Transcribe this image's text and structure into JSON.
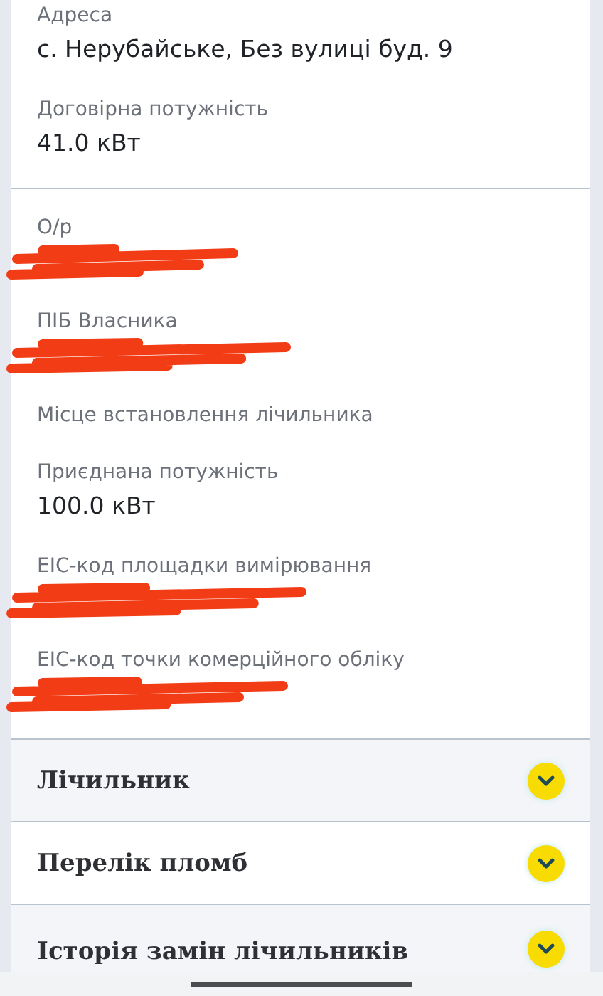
{
  "sections": [
    {
      "fields": [
        {
          "label": "Адреса",
          "value": "с. Нерубайське, Без вулиці буд. 9"
        },
        {
          "label": "Договірна потужність",
          "value": "41.0 кВт"
        }
      ]
    },
    {
      "fields": [
        {
          "label": "О/р",
          "redacted": true
        },
        {
          "label": "ПІБ Власника",
          "redacted": true
        },
        {
          "label": "Місце встановлення лічильника"
        },
        {
          "label": "Приєднана потужність",
          "value": "100.0 кВт"
        },
        {
          "label": "ЕІС-код площадки вимірювання",
          "redacted": true
        },
        {
          "label": "ЕІС-код точки комерційного обліку",
          "redacted": true
        }
      ]
    }
  ],
  "accordions": [
    {
      "title": "Лічильник",
      "expanded": false
    },
    {
      "title": "Перелік пломб",
      "expanded": false
    },
    {
      "title": "Історія замін лічильників",
      "expanded": false
    }
  ]
}
